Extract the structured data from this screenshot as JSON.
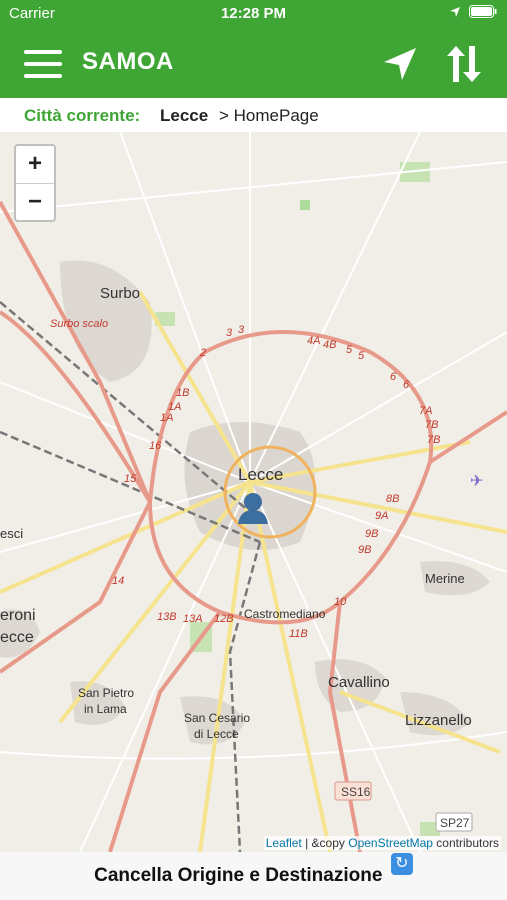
{
  "status_bar": {
    "carrier": "Carrier",
    "time": "12:28 PM"
  },
  "app_bar": {
    "title": "SAMOA"
  },
  "breadcrumb": {
    "label": "Città corrente:",
    "city": "Lecce",
    "page": "> HomePage"
  },
  "map": {
    "zoom_in": "+",
    "zoom_out": "−",
    "towns": {
      "surbo": "Surbo",
      "surbo_scalo": "Surbo scalo",
      "lecce": "Lecce",
      "esci": "esci",
      "eroni": "eroni",
      "ecce": "ecce",
      "merine": "Merine",
      "castromediano": "Castromediano",
      "cavallino": "Cavallino",
      "san_pietro": "San Pietro",
      "in_lama": "in Lama",
      "san_cesario": "San Cesario",
      "di_lecce": "di Lecce",
      "lizzanello": "Lizzanello"
    },
    "roads": [
      "3",
      "3",
      "2",
      "4A",
      "4B",
      "5",
      "5",
      "6",
      "6",
      "1B",
      "1A",
      "1A",
      "7A",
      "7B",
      "7B",
      "16",
      "15",
      "8B",
      "9A",
      "9B",
      "9B",
      "14",
      "13B",
      "13A",
      "12B",
      "11B",
      "10",
      "SS16",
      "SP27"
    ],
    "attribution": {
      "leaflet": "Leaflet",
      "sep": " | &copy ",
      "osm": "OpenStreetMap",
      "contrib": " contributors"
    }
  },
  "bottom": {
    "label": "Cancella Origine e Destinazione",
    "icon": "refresh-icon"
  },
  "colors": {
    "accent": "#3fa535"
  }
}
